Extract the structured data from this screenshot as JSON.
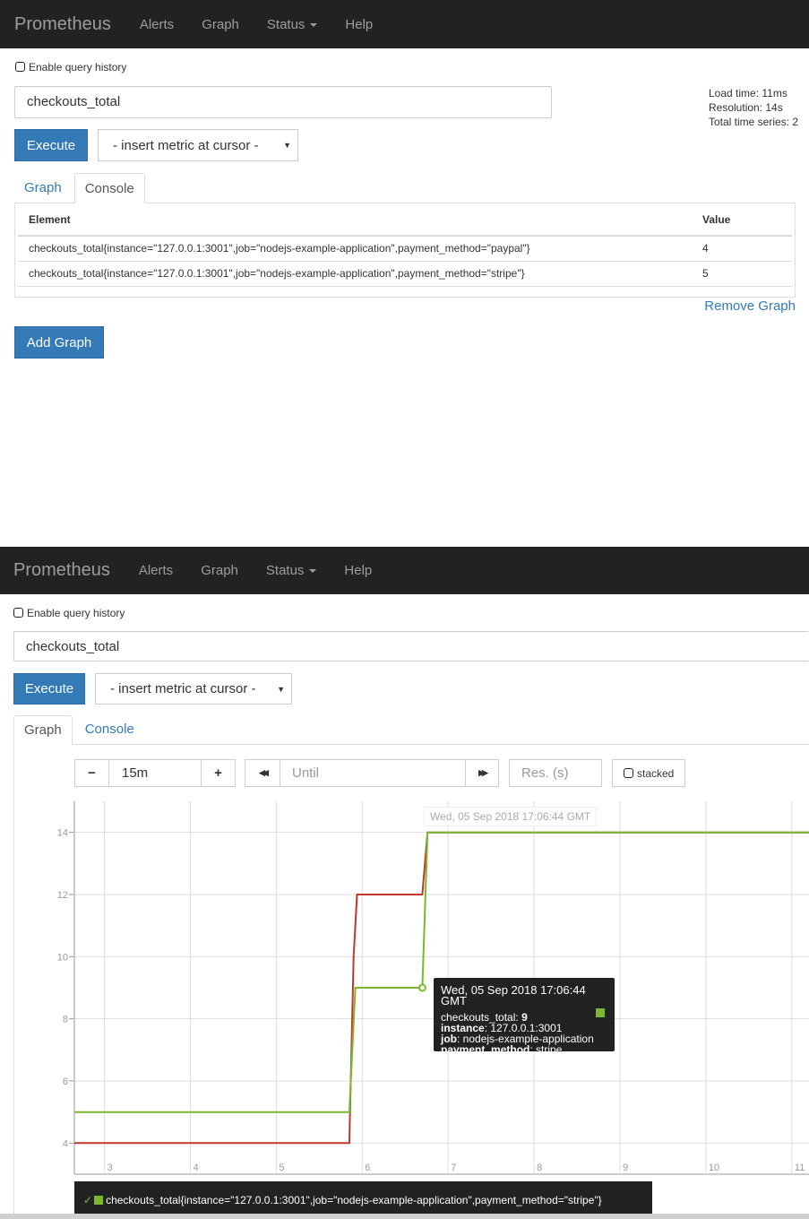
{
  "top": {
    "nav": {
      "brand": "Prometheus",
      "alerts": "Alerts",
      "graph": "Graph",
      "status": "Status",
      "help": "Help"
    },
    "history_label": "Enable query history",
    "expression": "checkouts_total",
    "stats": {
      "load_time": "Load time: 11ms",
      "resolution": "Resolution: 14s",
      "total_series": "Total time series: 2"
    },
    "execute_label": "Execute",
    "insert_metric": "- insert metric at cursor -",
    "tabs": {
      "graph": "Graph",
      "console": "Console"
    },
    "table": {
      "headers": {
        "element": "Element",
        "value": "Value"
      },
      "rows": [
        {
          "element": "checkouts_total{instance=\"127.0.0.1:3001\",job=\"nodejs-example-application\",payment_method=\"paypal\"}",
          "value": "4"
        },
        {
          "element": "checkouts_total{instance=\"127.0.0.1:3001\",job=\"nodejs-example-application\",payment_method=\"stripe\"}",
          "value": "5"
        }
      ]
    },
    "remove_graph": "Remove Graph",
    "add_graph": "Add Graph"
  },
  "bottom": {
    "nav": {
      "brand": "Prometheus",
      "alerts": "Alerts",
      "graph": "Graph",
      "status": "Status",
      "help": "Help"
    },
    "history_label": "Enable query history",
    "expression": "checkouts_total",
    "execute_label": "Execute",
    "insert_metric": "- insert metric at cursor -",
    "tabs": {
      "graph": "Graph",
      "console": "Console"
    },
    "controls": {
      "minus": "−",
      "range": "15m",
      "plus": "+",
      "back": "◀◀",
      "until_placeholder": "Until",
      "forward": "▶▶",
      "res_placeholder": "Res. (s)",
      "stacked": "stacked"
    },
    "hover_time": "Wed, 05 Sep 2018 17:06:44 GMT",
    "tooltip": {
      "time": "Wed, 05 Sep 2018 17:06:44 GMT",
      "metric": "checkouts_total",
      "value": "9",
      "instance_key": "instance",
      "instance_val": "127.0.0.1:3001",
      "job_key": "job",
      "job_val": "nodejs-example-application",
      "pm_key": "payment_method",
      "pm_val": "stripe"
    },
    "legend_text": "checkouts_total{instance=\"127.0.0.1:3001\",job=\"nodejs-example-application\",payment_method=\"stripe\"}"
  },
  "colors": {
    "stripe": "#7cb82f",
    "paypal": "#c0392b",
    "primary": "#337ab7",
    "navbar": "#222222"
  },
  "chart_data": {
    "type": "line",
    "x_ticks": [
      "3",
      "4",
      "5",
      "6",
      "7",
      "8",
      "9",
      "10",
      "11"
    ],
    "y_ticks": [
      "4",
      "6",
      "8",
      "10",
      "12",
      "14"
    ],
    "xlim": [
      2.65,
      11.2
    ],
    "ylim": [
      3.0,
      15.0
    ],
    "series": [
      {
        "name": "checkouts_total{instance=\"127.0.0.1:3001\",job=\"nodejs-example-application\",payment_method=\"stripe\"}",
        "color": "#7cb82f",
        "points": [
          [
            2.65,
            5
          ],
          [
            5.85,
            5
          ],
          [
            5.92,
            9
          ],
          [
            6.7,
            9
          ],
          [
            6.76,
            14
          ],
          [
            11.2,
            14
          ]
        ]
      },
      {
        "color": "#c0392b",
        "points": [
          [
            2.65,
            4
          ],
          [
            5.85,
            4
          ],
          [
            5.9,
            10
          ],
          [
            5.94,
            12
          ],
          [
            6.7,
            12
          ],
          [
            6.76,
            14
          ],
          [
            11.2,
            14
          ]
        ]
      }
    ],
    "hover_point": [
      6.7,
      9
    ],
    "grid": true
  }
}
